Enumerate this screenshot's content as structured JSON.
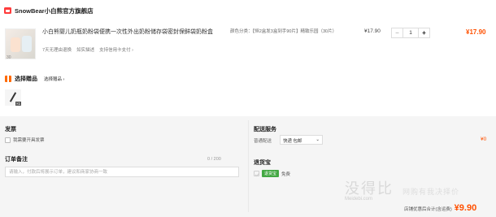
{
  "shop": {
    "name": "SnowBear小白熊官方旗舰店"
  },
  "item": {
    "title": "小白熊婴儿奶瓶奶粉袋便携一次性外出奶粉储存袋密封保鲜袋奶粉盒",
    "thumb_caption": "30",
    "services": [
      "7天无理由退换",
      "如实描述",
      "支持信用卡支付"
    ],
    "service_arrow": "›",
    "sku": "颜色分类：【恒2盒发3盒到手90片】精致乐园（30片）",
    "price": "¥17.90",
    "quantity": "1",
    "minus": "−",
    "plus": "+",
    "subtotal": "¥17.90"
  },
  "gift": {
    "title": "选择赠品",
    "link": "选择赠品 ›",
    "badge": "×1",
    "icon": "gift-icon"
  },
  "invoice": {
    "title": "发票",
    "checkbox_label": "我需要开具发票"
  },
  "remark": {
    "title": "订单备注",
    "count": "0 / 200",
    "placeholder": "请输入，付款后将展示订单，建议和商家协商一致"
  },
  "shipping": {
    "title": "配送服务",
    "label": "普通配送",
    "method": "快递 包邮",
    "price": "¥0"
  },
  "insurance": {
    "title": "退货宝",
    "tag": "退货宝",
    "free": "免费"
  },
  "watermark": {
    "main": "没得比",
    "site": "Meidebi.com",
    "sub": "网购有我决择价"
  },
  "total": {
    "label": "店铺优惠后合计(含运费)",
    "value": "¥9.90"
  },
  "colors": {
    "accent": "#ff5000",
    "brand": "#ff3c3c",
    "insure_green": "#43a843"
  }
}
